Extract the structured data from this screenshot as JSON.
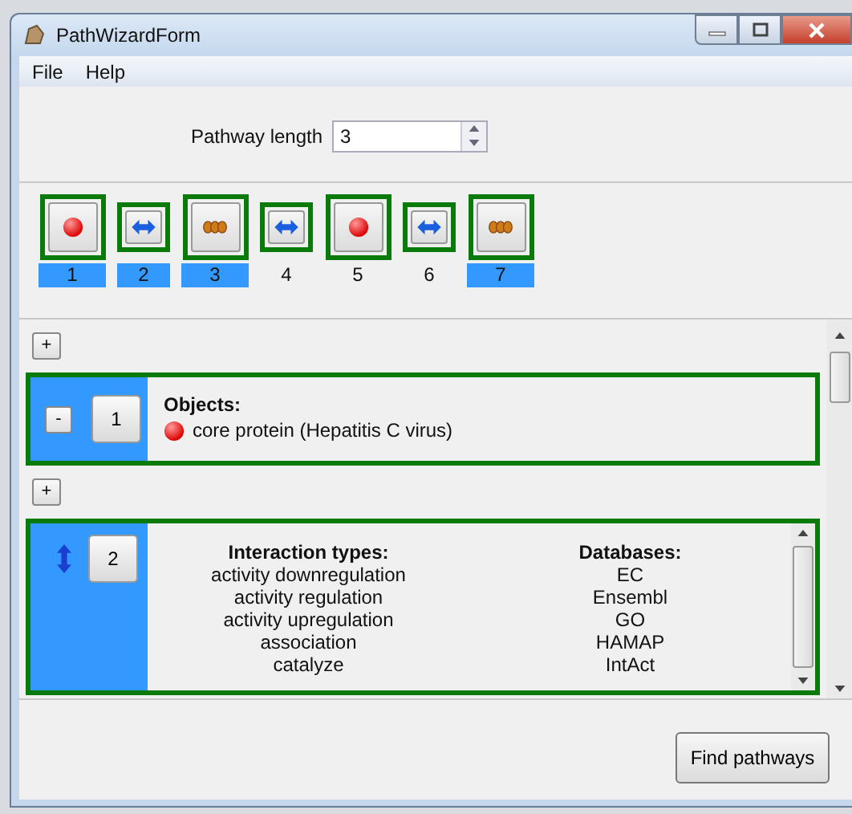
{
  "window": {
    "title": "PathWizardForm"
  },
  "menu": [
    "File",
    "Help"
  ],
  "pathway_length": {
    "label": "Pathway length",
    "value": "3"
  },
  "steps": [
    {
      "kind": "object",
      "label": "1",
      "selected": true
    },
    {
      "kind": "interaction",
      "label": "2",
      "selected": true
    },
    {
      "kind": "chain",
      "label": "3",
      "selected": true
    },
    {
      "kind": "interaction",
      "label": "4",
      "selected": false
    },
    {
      "kind": "object",
      "label": "5",
      "selected": false
    },
    {
      "kind": "interaction",
      "label": "6",
      "selected": false
    },
    {
      "kind": "chain",
      "label": "7",
      "selected": true
    }
  ],
  "panels": [
    {
      "kind": "objects",
      "add_label": "+",
      "toggle": "-",
      "index": "1",
      "heading": "Objects:",
      "items": [
        "core protein (Hepatitis C virus)"
      ]
    },
    {
      "kind": "interactions",
      "add_label": "+",
      "index": "2",
      "types_heading": "Interaction types:",
      "types": [
        "activity downregulation",
        "activity regulation",
        "activity upregulation",
        "association",
        "catalyze"
      ],
      "databases_heading": "Databases:",
      "databases": [
        "EC",
        "Ensembl",
        "GO",
        "HAMAP",
        "IntAct"
      ]
    }
  ],
  "find_button": "Find pathways"
}
